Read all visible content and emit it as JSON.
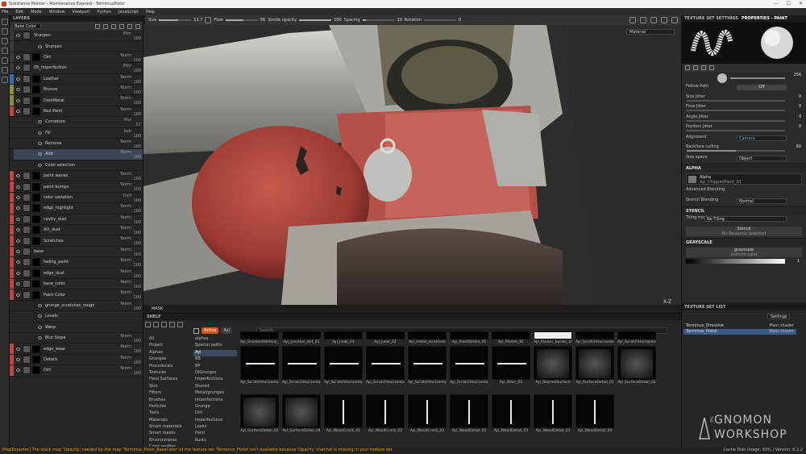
{
  "window": {
    "title": "Substance Painter - Maintenance Expired - TerminusPistol"
  },
  "menu": [
    "File",
    "Edit",
    "Mode",
    "Window",
    "Viewport",
    "Python",
    "JavaScript",
    "Help"
  ],
  "toolbar": {
    "size_label": "Size",
    "size_value": "11.7",
    "flow_label": "Flow",
    "flow_value": "56",
    "stroke_label": "Stroke opacity",
    "stroke_value": "100",
    "spacing_label": "Spacing",
    "spacing_value": "10",
    "rotation_label": "Rotation",
    "rotation_value": "0",
    "brush_icon": "brush-icon",
    "right_icons": [
      "camera-icon",
      "grid-icon",
      "screenshot-icon",
      "video-icon",
      "settings-icon"
    ]
  },
  "layers": {
    "panel_title": "LAYERS",
    "channel": "Base Color",
    "rows": [
      {
        "name": "Sharpen",
        "blend": "Pthr",
        "opacity": "100",
        "color": "#3a3a3a",
        "mask": false,
        "sub": false
      },
      {
        "name": "Sharpen",
        "blend": "",
        "opacity": "",
        "color": "#3a3a3a",
        "mask": false,
        "sub": true
      },
      {
        "name": "Dirt",
        "blend": "Norm",
        "opacity": "100",
        "color": "#3a3a3a",
        "mask": true,
        "sub": false
      },
      {
        "name": "05_Imperfection",
        "blend": "Pthr",
        "opacity": "100",
        "color": "#3a3a3a",
        "mask": false,
        "sub": false
      },
      {
        "name": "Leather",
        "blend": "Norm",
        "opacity": "100",
        "color": "#3d6aa8",
        "mask": true,
        "sub": false
      },
      {
        "name": "Bronze",
        "blend": "Norm",
        "opacity": "100",
        "color": "#8a8a4a",
        "mask": true,
        "sub": false
      },
      {
        "name": "DarkMetal",
        "blend": "Norm",
        "opacity": "100",
        "color": "#8a8a4a",
        "mask": true,
        "sub": false
      },
      {
        "name": "Red Paint",
        "blend": "Norm",
        "opacity": "100",
        "color": "#b54a4a",
        "mask": true,
        "sub": false
      },
      {
        "name": "Curvature",
        "blend": "Mul",
        "opacity": "57",
        "color": "#262626",
        "mask": false,
        "sub": true
      },
      {
        "name": "Fill",
        "blend": "Sub",
        "opacity": "100",
        "color": "#262626",
        "mask": false,
        "sub": true
      },
      {
        "name": "Remove",
        "blend": "Norm",
        "opacity": "100",
        "color": "#262626",
        "mask": false,
        "sub": true
      },
      {
        "name": "Add",
        "blend": "Norm",
        "opacity": "100",
        "color": "#262626",
        "mask": false,
        "sub": true,
        "selected": true
      },
      {
        "name": "Color selection",
        "blend": "",
        "opacity": "",
        "color": "#262626",
        "mask": false,
        "sub": true
      },
      {
        "name": "paint waves",
        "blend": "Norm",
        "opacity": "100",
        "color": "#b54a4a",
        "mask": true,
        "sub": false
      },
      {
        "name": "paint bumps",
        "blend": "Norm",
        "opacity": "100",
        "color": "#b54a4a",
        "mask": true,
        "sub": false
      },
      {
        "name": "color variation",
        "blend": "Ovrl",
        "opacity": "100",
        "color": "#b54a4a",
        "mask": true,
        "sub": false
      },
      {
        "name": "edge_highlight",
        "blend": "Norm",
        "opacity": "100",
        "color": "#b54a4a",
        "mask": true,
        "sub": false
      },
      {
        "name": "cavity_dust",
        "blend": "Norm",
        "opacity": "100",
        "color": "#b54a4a",
        "mask": true,
        "sub": false
      },
      {
        "name": "AO_dust",
        "blend": "Norm",
        "opacity": "100",
        "color": "#b54a4a",
        "mask": true,
        "sub": false
      },
      {
        "name": "Scratches",
        "blend": "Norm",
        "opacity": "100",
        "color": "#b54a4a",
        "mask": true,
        "sub": false
      },
      {
        "name": "base",
        "blend": "Norm",
        "opacity": "100",
        "color": "#b54a4a",
        "mask": false,
        "sub": false
      },
      {
        "name": "fading_paint",
        "blend": "Norm",
        "opacity": "100",
        "color": "#b54a4a",
        "mask": true,
        "sub": false
      },
      {
        "name": "edge_dust",
        "blend": "Norm",
        "opacity": "100",
        "color": "#b54a4a",
        "mask": true,
        "sub": false
      },
      {
        "name": "base_color",
        "blend": "Norm",
        "opacity": "100",
        "color": "#b54a4a",
        "mask": true,
        "sub": false
      },
      {
        "name": "Paint Color",
        "blend": "Norm",
        "opacity": "100",
        "color": "#b54a4a",
        "mask": true,
        "sub": false
      },
      {
        "name": "grunge_scratches_rough",
        "blend": "Norm",
        "opacity": "100",
        "color": "#262626",
        "mask": false,
        "sub": true
      },
      {
        "name": "Levels",
        "blend": "",
        "opacity": "",
        "color": "#262626",
        "mask": false,
        "sub": true
      },
      {
        "name": "Warp",
        "blend": "",
        "opacity": "",
        "color": "#262626",
        "mask": false,
        "sub": true
      },
      {
        "name": "Blur Slope",
        "blend": "Norm",
        "opacity": "100",
        "color": "#262626",
        "mask": false,
        "sub": true
      },
      {
        "name": "edge_wear",
        "blend": "Norm",
        "opacity": "100",
        "color": "#b54a4a",
        "mask": true,
        "sub": false
      },
      {
        "name": "Details",
        "blend": "Norm",
        "opacity": "100",
        "color": "#b54a4a",
        "mask": true,
        "sub": false
      },
      {
        "name": "Dirt",
        "blend": "Norm",
        "opacity": "100",
        "color": "#b54a4a",
        "mask": true,
        "sub": false
      }
    ]
  },
  "viewport": {
    "material_mode": "Material",
    "axes_label": "X-Z",
    "mask_label": "MASK"
  },
  "shelf": {
    "title": "SHELF",
    "tabs": [
      "Active",
      "Ayi"
    ],
    "search_placeholder": "Search...",
    "categories": [
      "All",
      "Project",
      "Alphas",
      "Grunges",
      "Procedurals",
      "Textures",
      "Hard Surfaces",
      "Skin",
      "Filters",
      "Brushes",
      "Particles",
      "Tools",
      "Materials",
      "Smart materials",
      "Smart masks",
      "Environments",
      "Color profiles"
    ],
    "paths": [
      "alphas",
      "Special paths",
      "Ayi",
      "BB",
      "BP",
      "OlGrunges",
      "Imperfections",
      "Shared",
      "Metal/grunges",
      "Imperfections",
      "Grunge",
      "Dirt",
      "Imperfections",
      "Leaks",
      "Paint",
      "Rusts"
    ],
    "items_row0": [
      "Ayi_GradientVertical_02",
      "Ayi_Junction_dirt_01",
      "Ayi_Leak_01",
      "Ayi_Leak_02",
      "Ayi_metal_scratches",
      "Ayi_PaintStroke_01",
      "Ayi_Plaster_01",
      "Ayi_Plaster_border_01",
      "Ayi_ScratchHorizonta...",
      "Ayi_ScratchHorizonta..."
    ],
    "items_row1": [
      "Ayi_ScratchHorizonta...",
      "Ayi_ScratchHorizonta...",
      "Ayi_ScratchHorizonta...",
      "Ayi_ScratchHorizonta...",
      "Ayi_ScratchHorizonta...",
      "Ayi_ScratchHorizonta...",
      "Ayi_Stain_01",
      "Ayi_StainedSurface",
      "Ayi_SurfaceDetail_01",
      "Ayi_SurfaceDetail_02"
    ],
    "items_row2": [
      "Ayi_SurfaceDetail_03",
      "Ayi_SurfaceDetail_04",
      "Ayi_WoodCrack_01",
      "Ayi_WoodCrack_02",
      "Ayi_WoodCrack_03",
      "Ayi_WoodDetail_01",
      "Ayi_WoodDetail_02",
      "Ayi_WoodDetail_03",
      "Ayi_WoodDetail_04"
    ]
  },
  "properties": {
    "tab_texture_set_settings": "TEXTURE SET SETTINGS",
    "tab_properties": "PROPERTIES - PAINT",
    "size_value": "256",
    "rows": [
      {
        "label": "Follow Path",
        "kind": "button",
        "value": "Off"
      },
      {
        "label": "Size Jitter",
        "kind": "slider",
        "value": "0",
        "fill": 0.0
      },
      {
        "label": "Flow Jitter",
        "kind": "slider",
        "value": "0",
        "fill": 0.0
      },
      {
        "label": "Angle Jitter",
        "kind": "slider",
        "value": "0",
        "fill": 0.0
      },
      {
        "label": "Position Jitter",
        "kind": "slider",
        "value": "0",
        "fill": 0.0
      },
      {
        "label": "Alignment",
        "kind": "dropdown",
        "value": "Camera",
        "blue": true
      },
      {
        "label": "Backface culling",
        "kind": "slider",
        "value": "90",
        "fill": 0.5
      },
      {
        "label": "Size space",
        "kind": "dropdown",
        "value": "Object",
        "blue": false
      }
    ],
    "alpha_section": "ALPHA",
    "alpha_name": "Alpha",
    "alpha_file": "Ayi_ChippedPaint_01",
    "advanced_blending": "Advanced Blending",
    "stencil_blending_label": "Stencil Blending",
    "stencil_blending_value": "Normal",
    "stencil_section": "STENCIL",
    "tiling_label": "Tiling mode",
    "tiling_value": "No Tiling",
    "stencil_btn": "Stencil",
    "stencil_sub": "No Resource Selected",
    "grayscale_section": "GRAYSCALE",
    "grayscale_btn": "grayscale",
    "grayscale_sub": "uniform color",
    "grayscale_value": "1"
  },
  "texture_set_list": {
    "title": "TEXTURE SET LIST",
    "settings_label": "Settings",
    "sets": [
      {
        "name": "Terminus_Emissive",
        "shader": "Main shader"
      },
      {
        "name": "Terminus_Pistol",
        "shader": "Main shader"
      }
    ]
  },
  "watermark": {
    "line0": "THE",
    "line1": "GNOMON",
    "line2": "WORKSHOP"
  },
  "status": {
    "message": "[MapExporter] The stack map 'Opacity' needed by the map 'Terminus_Pistol_BaseColor' of the texture set 'Terminus_Pistol' isn't available because 'Opacity' channel is missing in your texture set.",
    "right": "Cache Disk Usage: 93% | Version: 6.2.2"
  }
}
